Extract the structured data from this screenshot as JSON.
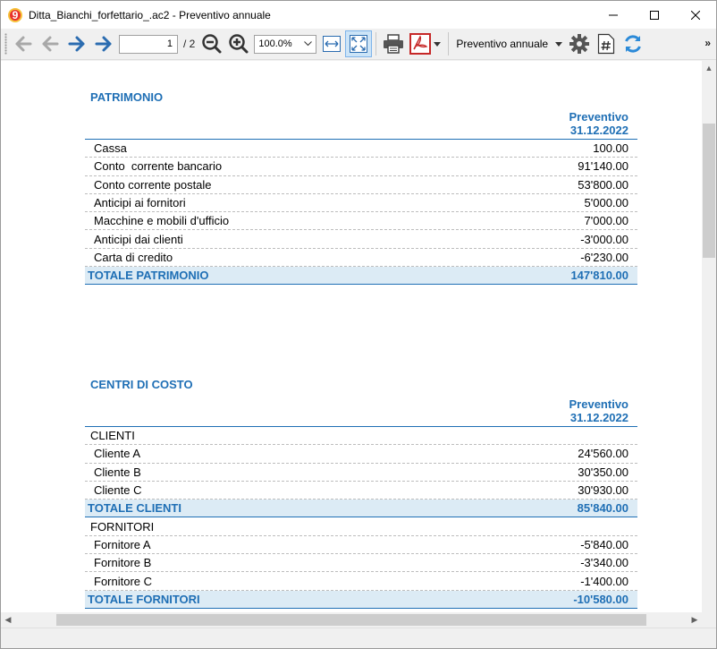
{
  "window": {
    "logo_glyph": "9",
    "title": "Ditta_Bianchi_forfettario_.ac2 - Preventivo annuale"
  },
  "toolbar": {
    "page_current": "1",
    "page_total": "/ 2",
    "zoom_value": "100.0%",
    "report_name": "Preventivo annuale",
    "icons": [
      "first-page-icon",
      "previous-page-icon",
      "next-page-icon",
      "last-page-icon",
      "zoom-out-icon",
      "zoom-in-icon",
      "fit-width-icon",
      "fit-page-icon",
      "print-icon",
      "pdf-icon",
      "settings-icon",
      "hash-icon",
      "refresh-icon"
    ],
    "accent_color": "#1f6fb5"
  },
  "report": {
    "patrimonio": {
      "title": "PATRIMONIO",
      "header_line1": "Preventivo",
      "header_line2": "31.12.2022",
      "rows": [
        {
          "label": "Cassa",
          "value": "100.00"
        },
        {
          "label": "Conto  corrente bancario",
          "value": "91'140.00"
        },
        {
          "label": "Conto corrente postale",
          "value": "53'800.00"
        },
        {
          "label": "Anticipi ai fornitori",
          "value": "5'000.00"
        },
        {
          "label": "Macchine e mobili d'ufficio",
          "value": "7'000.00"
        },
        {
          "label": "Anticipi dai clienti",
          "value": "-3'000.00"
        },
        {
          "label": "Carta di credito",
          "value": "-6'230.00"
        }
      ],
      "total_label": "TOTALE PATRIMONIO",
      "total_value": "147'810.00"
    },
    "centri": {
      "title": "CENTRI DI COSTO",
      "header_line1": "Preventivo",
      "header_line2": "31.12.2022",
      "clienti_group": "CLIENTI",
      "clienti_rows": [
        {
          "label": "Cliente A",
          "value": "24'560.00"
        },
        {
          "label": "Cliente B",
          "value": "30'350.00"
        },
        {
          "label": "Cliente C",
          "value": "30'930.00"
        }
      ],
      "clienti_total_label": "TOTALE CLIENTI",
      "clienti_total_value": "85'840.00",
      "fornitori_group": "FORNITORI",
      "fornitori_rows": [
        {
          "label": "Fornitore A",
          "value": "-5'840.00"
        },
        {
          "label": "Fornitore B",
          "value": "-3'340.00"
        },
        {
          "label": "Fornitore C",
          "value": "-1'400.00"
        }
      ],
      "fornitori_total_label": "TOTALE FORNITORI",
      "fornitori_total_value": "-10'580.00"
    }
  }
}
